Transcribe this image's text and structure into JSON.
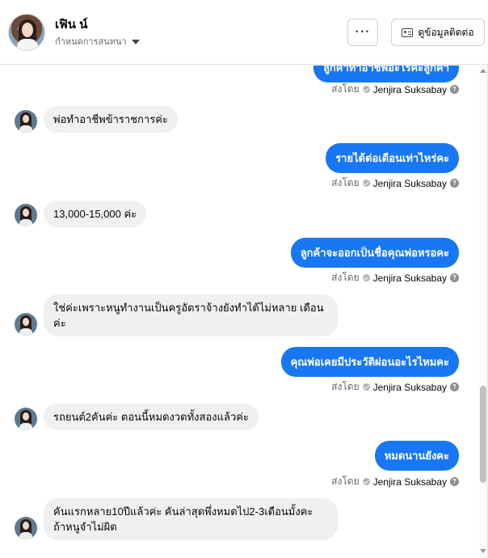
{
  "header": {
    "title": "เฟิน น์",
    "subtitle": "กำหนดการสนทนา",
    "more_label": "···",
    "contact_label": "ดูข้อมูลติดต่อ"
  },
  "thread": {
    "top_partial_message": "ลูกค้าทำอาชีพอะไรคะลูกค้า",
    "sent_by_prefix": "ส่งโดย",
    "sent_by_name": "Jenjira Suksabay",
    "messages": [
      {
        "dir": "in",
        "text": "พ่อทำอาชีพข้าราชการค่ะ"
      },
      {
        "dir": "out",
        "text": "รายได้ต่อเดือนเท่าไหร่คะ"
      },
      {
        "dir": "in",
        "text": "13,000-15,000 ค่ะ"
      },
      {
        "dir": "out",
        "text": "ลูกค้าจะออกเป็นชื่อคุณพ่อหรอคะ"
      },
      {
        "dir": "in",
        "text": "ใช่ค่ะเพราะหนูทำงานเป็นครูอัตราจ้างยังทำได้ไม่หลาย เดือนค่ะ"
      },
      {
        "dir": "out",
        "text": "คุณพ่อเคยมีประวัติผ่อนอะไรไหมคะ"
      },
      {
        "dir": "in",
        "text": "รถยนต์2คันค่ะ ตอนนี้หมดงวดทั้งสองแล้วค่ะ"
      },
      {
        "dir": "out",
        "text": "หมดนานยังคะ"
      },
      {
        "dir": "in",
        "text": "คันแรกหลาย10ปีแล้วค่ะ คันล่าสุดพึ่งหมดไป2-3เดือนมั้งคะ ถ้าหนูจำไม่ผิด"
      }
    ]
  },
  "colors": {
    "accent": "#1877f2",
    "incoming_bubble": "#f0f0f0",
    "muted_text": "#65676b"
  }
}
